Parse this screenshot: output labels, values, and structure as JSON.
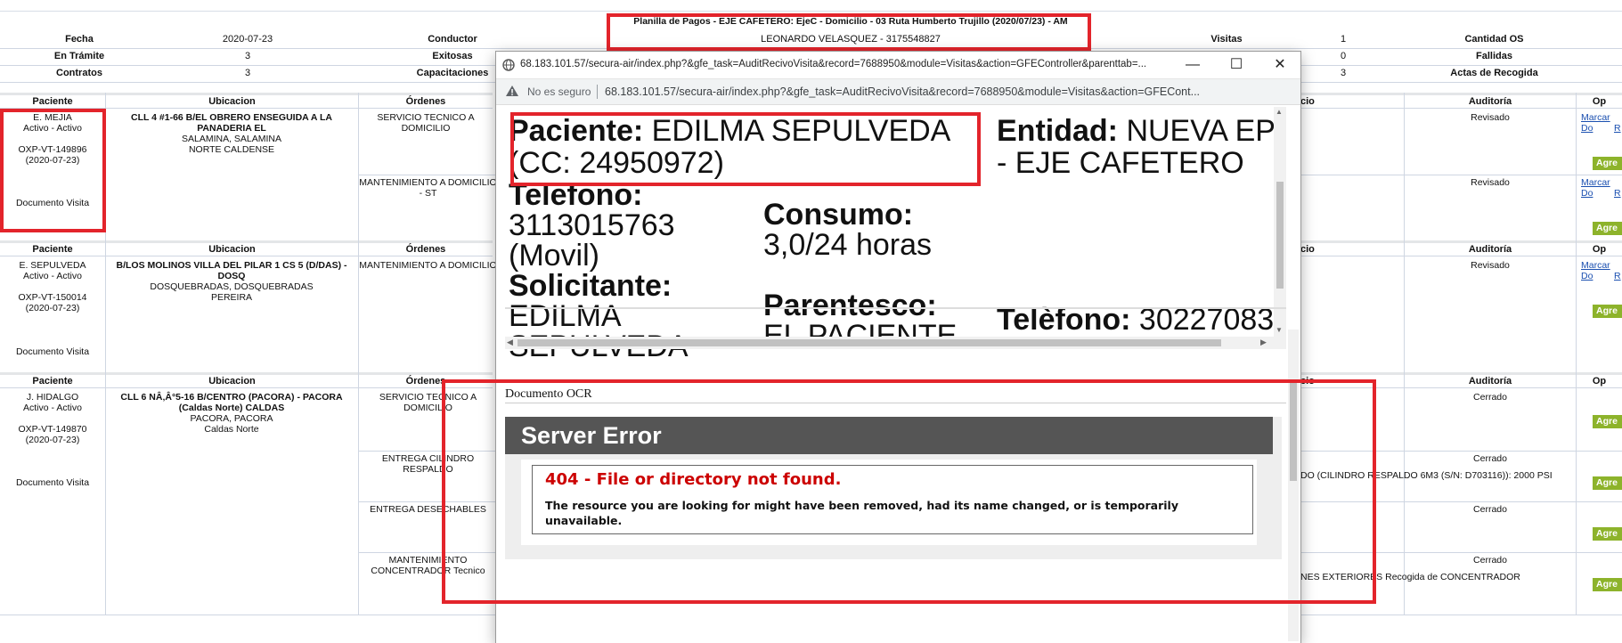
{
  "summary": {
    "title": "Planilla de Pagos - EJE CAFETERO: EjeC - Domicilio - 03 Ruta Humberto Trujillo (2020/07/23) - AM",
    "driver_line": "LEONARDO VELASQUEZ - 3175548827",
    "rows": [
      {
        "l1": "Fecha",
        "v1": "2020-07-23",
        "l2": "Conductor",
        "l3": "Visitas",
        "v3": "1",
        "l4": "Cantidad OS"
      },
      {
        "l1": "En Trámite",
        "v1": "3",
        "l2": "Exitosas",
        "l3": "",
        "v3": "0",
        "l4": "Fallidas"
      },
      {
        "l1": "Contratos",
        "v1": "3",
        "l2": "Capacitaciones",
        "l3": "",
        "v3": "3",
        "l4": "Actas de Recogida"
      }
    ]
  },
  "table": {
    "headers": {
      "paciente": "Paciente",
      "ubicacion": "Ubicacion",
      "ordenes": "Órdenes",
      "estado_partial": "cio",
      "auditoria": "Auditoría",
      "op_partial": "Op"
    },
    "records": [
      {
        "patient_name": "E. MEJIA",
        "status": "Activo - Activo",
        "code": "OXP-VT-149896",
        "date": "(2020-07-23)",
        "doc": "Documento Visita",
        "address": "CLL 4 #1-66 B/EL OBRERO ENSEGUIDA A LA PANADERIA EL",
        "city": "SALAMINA, SALAMINA",
        "region": "NORTE CALDENSE",
        "orders": [
          "SERVICIO TECNICO A DOMICILIO",
          "MANTENIMIENTO A DOMICILIO - ST"
        ],
        "audit": [
          "Revisado",
          "Revisado"
        ]
      },
      {
        "patient_name": "E. SEPULVEDA",
        "status": "Activo - Activo",
        "code": "OXP-VT-150014",
        "date": "(2020-07-23)",
        "doc": "Documento Visita",
        "address": "B/LOS MOLINOS VILLA DEL PILAR 1 CS 5 (D/DAS) - DOSQ",
        "city": "DOSQUEBRADAS, DOSQUEBRADAS",
        "region": "PEREIRA",
        "orders": [
          "MANTENIMIENTO A DOMICILIO"
        ],
        "audit": [
          "Revisado"
        ]
      },
      {
        "patient_name": "J. HIDALGO",
        "status": "Activo - Activo",
        "code": "OXP-VT-149870",
        "date": "(2020-07-23)",
        "doc": "Documento Visita",
        "address": "CLL 6 NÂ‚Â°5-16 B/CENTRO (PACORA) - PACORA (Caldas Norte) CALDAS",
        "city": "PACORA, PACORA",
        "region": "Caldas Norte",
        "orders": [
          "SERVICIO TECNICO A DOMICILIO",
          "ENTREGA CILINDRO RESPALDO",
          "ENTREGA DESECHABLES",
          "MANTENIMIENTO CONCENTRADOR Tecnico"
        ],
        "audit": [
          "Cerrado",
          "Cerrado",
          "Cerrado",
          "Cerrado"
        ],
        "notes": [
          "DO (CILINDRO RESPALDO 6M3 (S/N: D703116)): 2000 PSI",
          "NES EXTERIORES Recogida de CONCENTRADOR"
        ]
      }
    ],
    "link_partial_1": "Marcar Do",
    "link_partial_2": "R",
    "agr_label": "Agre"
  },
  "popup": {
    "window_title": "68.183.101.57/secura-air/index.php?&gfe_task=AuditRecivoVisita&record=7688950&module=Visitas&action=GFEController&parenttab=...",
    "not_secure": "No es seguro",
    "url": "68.183.101.57/secura-air/index.php?&gfe_task=AuditRecivoVisita&record=7688950&module=Visitas&action=GFECont...",
    "paciente_label": "Paciente:",
    "paciente_value": "EDILMA SEPULVEDA",
    "paciente_cc": "(CC: 24950972)",
    "entidad_label": "Entidad:",
    "entidad_value": "NUEVA EP",
    "entidad_value2": "- EJE CAFETERO",
    "telefono_label": "Telefono:",
    "telefono_value": "3113015763",
    "telefono_type": "(Movil)",
    "consumo_label": "Consumo:",
    "consumo_value": "3,0/24 horas",
    "solicitante_label": "Solicitante:",
    "solicitante_value": "EDILMA",
    "solicitante_value2": "SEPULVEDA",
    "parentesco_label": "Parentesco:",
    "parentesco_value": "EL PACIENTE",
    "telefono2_label": "Telèfono:",
    "telefono2_value": "30227083",
    "ocr_label": "Documento OCR",
    "error_header": "Server Error",
    "error_title": "404 - File or directory not found.",
    "error_text": "The resource you are looking for might have been removed, had its name changed, or is temporarily unavailable."
  },
  "colors": {
    "highlight": "#e3242b",
    "agr_button": "#8db32b",
    "error_red": "#cc0000"
  },
  "icons": {
    "window_icon": "globe-icon",
    "minimize": "minimize-icon",
    "maximize": "maximize-icon",
    "close": "close-icon",
    "warning": "warning-icon"
  }
}
